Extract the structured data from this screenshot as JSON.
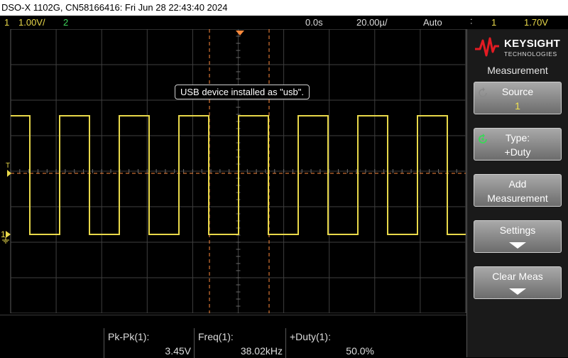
{
  "title_bar": "DSO-X 1102G, CN58166416: Fri Jun 28 22:43:40 2024",
  "status": {
    "ch1_number": "1",
    "ch1_scale": "1.00V/",
    "ch2_number": "2",
    "time_delay": "0.0s",
    "time_scale": "20.00µ/",
    "trigger_mode": "Auto",
    "trigger_channel": "1",
    "trigger_level": "1.70V"
  },
  "toast": "USB device installed as \"usb\".",
  "markers": {
    "trigger_level": "T",
    "ch1_ground": "1"
  },
  "measurements": [
    {
      "label": "Pk-Pk(1):",
      "value": "3.45V"
    },
    {
      "label": "Freq(1):",
      "value": "38.02kHz"
    },
    {
      "label": "+Duty(1):",
      "value": "50.0%"
    }
  ],
  "panel": {
    "brand": "KEYSIGHT",
    "brand_sub": "TECHNOLOGIES",
    "menu_title": "Measurement",
    "softkeys": [
      {
        "line1": "Source",
        "line2": "1"
      },
      {
        "line1": "Type:",
        "line2": "+Duty"
      },
      {
        "line1": "Add",
        "line2": "Measurement"
      },
      {
        "line1": "Settings",
        "line2": ""
      },
      {
        "line1": "Clear Meas",
        "line2": ""
      }
    ]
  },
  "colors": {
    "ch1": "#e8d84a",
    "ch2": "#3ed35a",
    "cursor": "#ff8a3c",
    "grid": "#3f3f3f"
  },
  "waveform": {
    "type": "square",
    "duty": 0.5,
    "high_level_div": 3.0,
    "low_level_div": -0.5
  }
}
